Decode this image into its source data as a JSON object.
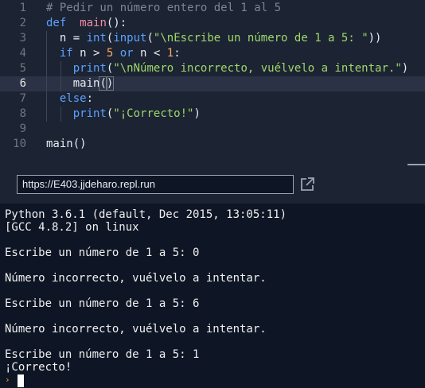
{
  "editor": {
    "lines": [
      {
        "num": "1",
        "parts": [
          [
            "cm",
            "# Pedir un número entero del 1 al 5"
          ]
        ]
      },
      {
        "num": "2",
        "parts": [
          [
            "kw",
            "def"
          ],
          [
            "",
            "  "
          ],
          [
            "fn",
            "main"
          ],
          [
            "",
            "():"
          ]
        ]
      },
      {
        "num": "3",
        "parts": [
          [
            "",
            "  n = "
          ],
          [
            "kw",
            "int"
          ],
          [
            "",
            "("
          ],
          [
            "kw",
            "input"
          ],
          [
            "",
            "("
          ],
          [
            "str",
            "\"\\nEscribe un número de 1 a 5: \""
          ],
          [
            "",
            "))"
          ]
        ]
      },
      {
        "num": "4",
        "parts": [
          [
            "",
            "  "
          ],
          [
            "kw",
            "if"
          ],
          [
            "",
            " n > "
          ],
          [
            "num",
            "5"
          ],
          [
            "",
            " "
          ],
          [
            "kw",
            "or"
          ],
          [
            "",
            " n < "
          ],
          [
            "num",
            "1"
          ],
          [
            "",
            ":"
          ]
        ]
      },
      {
        "num": "5",
        "parts": [
          [
            "",
            "    "
          ],
          [
            "kw",
            "print"
          ],
          [
            "",
            "("
          ],
          [
            "str",
            "\"\\nNúmero incorrecto, vuélvelo a intentar.\""
          ],
          [
            "",
            ")"
          ]
        ]
      },
      {
        "num": "6",
        "parts": [
          [
            "",
            "    main"
          ],
          [
            "br",
            "("
          ],
          [
            "br",
            ")"
          ]
        ]
      },
      {
        "num": "7",
        "parts": [
          [
            "",
            "  "
          ],
          [
            "kw",
            "else"
          ],
          [
            "",
            ":"
          ]
        ]
      },
      {
        "num": "8",
        "parts": [
          [
            "",
            "    "
          ],
          [
            "kw",
            "print"
          ],
          [
            "",
            "("
          ],
          [
            "str",
            "\"¡Correcto!\""
          ],
          [
            "",
            ")"
          ]
        ]
      },
      {
        "num": "9",
        "parts": []
      },
      {
        "num": "10",
        "parts": [
          [
            "",
            "main()"
          ]
        ]
      }
    ]
  },
  "url": "https://E403.jjdeharo.repl.run",
  "console": {
    "lines": [
      "Python 3.6.1 (default, Dec 2015, 13:05:11)",
      "[GCC 4.8.2] on linux",
      "",
      "Escribe un número de 1 a 5: 0",
      "",
      "Número incorrecto, vuélvelo a intentar.",
      "",
      "Escribe un número de 1 a 5: 6",
      "",
      "Número incorrecto, vuélvelo a intentar.",
      "",
      "Escribe un número de 1 a 5: 1",
      "¡Correcto!"
    ],
    "prompt_symbol": "›"
  }
}
